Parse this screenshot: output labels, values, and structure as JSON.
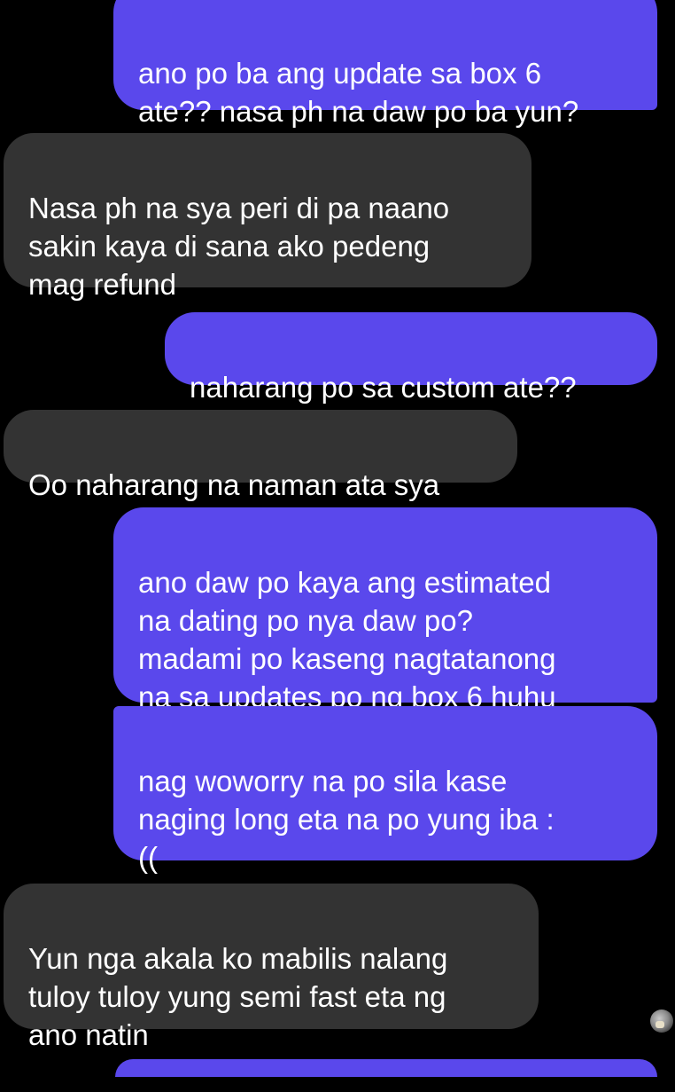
{
  "colors": {
    "background": "#000000",
    "sent_bubble": "#5a48ec",
    "received_bubble": "#333333",
    "text": "#ffffff"
  },
  "messages": [
    {
      "sender": "me",
      "text": "ano po ba ang update sa box 6\nate?? nasa ph na daw po ba yun?"
    },
    {
      "sender": "other",
      "text": "Nasa ph na sya peri di pa naano\nsakin kaya di sana ako pedeng\nmag refund"
    },
    {
      "sender": "me",
      "text": "naharang po sa custom ate??"
    },
    {
      "sender": "other",
      "text": "Oo naharang na naman ata sya"
    },
    {
      "sender": "me",
      "text": "ano daw po kaya ang estimated\nna dating po nya daw po?\nmadami po kaseng nagtatanong\nna sa updates po ng box 6 huhu"
    },
    {
      "sender": "me",
      "text": "nag woworry na po sila kase\nnaging long eta na po yung iba :\n(("
    },
    {
      "sender": "other",
      "text": "Yun nga akala ko mabilis nalang\ntuloy tuloy yung semi fast eta ng\nano natin"
    }
  ],
  "read_receipt_icon": "avatar-icon"
}
